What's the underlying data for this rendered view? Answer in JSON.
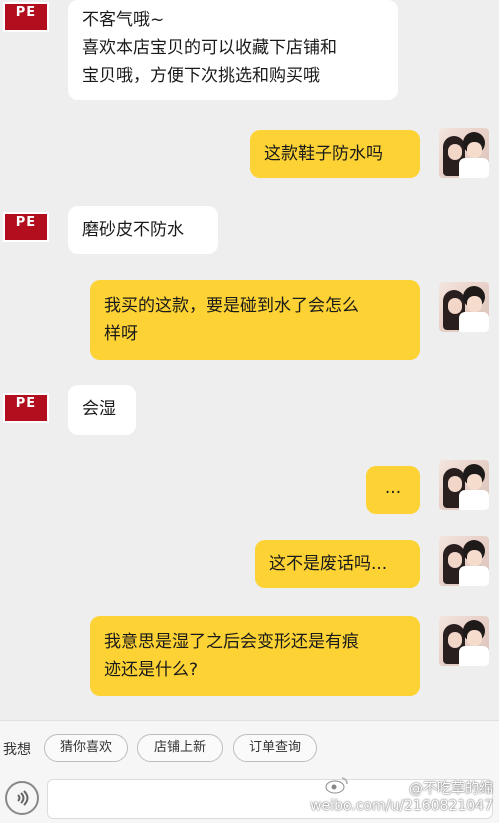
{
  "messages": [
    {
      "side": "left",
      "text": "不客气哦~\n喜欢本店宝贝的可以收藏下店铺和\n宝贝哦，方便下次挑选和购买哦"
    },
    {
      "side": "right",
      "text": "这款鞋子防水吗"
    },
    {
      "side": "left",
      "text": "磨砂皮不防水"
    },
    {
      "side": "right",
      "text": "我买的这款，要是碰到水了会怎么\n样呀"
    },
    {
      "side": "left",
      "text": "会湿"
    },
    {
      "side": "right",
      "text": "..."
    },
    {
      "side": "right",
      "text": "这不是废话吗..."
    },
    {
      "side": "right",
      "text": "我意思是湿了之后会变形还是有痕\n迹还是什么?"
    }
  ],
  "shop_avatar": {
    "logo": "PE"
  },
  "quick_replies": {
    "label": "我想",
    "items": [
      "猜你喜欢",
      "店铺上新",
      "订单查询"
    ]
  },
  "input": {
    "placeholder": ""
  },
  "watermark": {
    "line1": "@不吃草的绵",
    "line2": "weibo.com/u/2160821047"
  },
  "colors": {
    "right_bubble": "#fcd235",
    "left_bubble": "#ffffff",
    "shop_avatar": "#b30e1e",
    "background": "#eeeeee"
  }
}
